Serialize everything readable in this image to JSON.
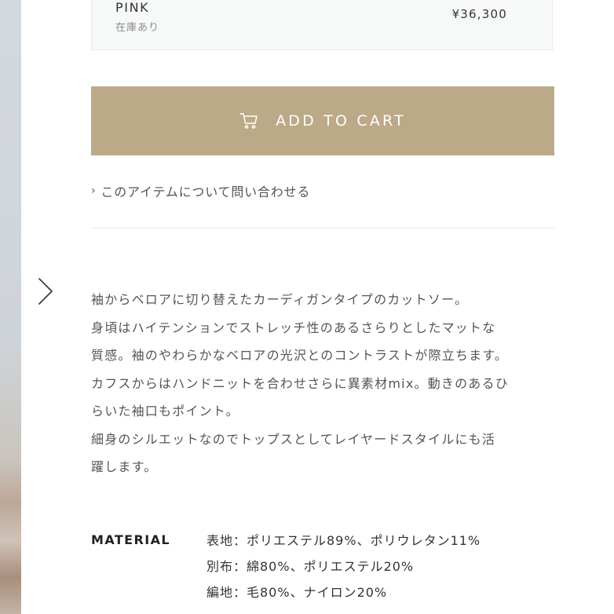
{
  "variant": {
    "color_name": "PINK",
    "stock_status": "在庫あり",
    "price": "¥36,300"
  },
  "cart_button": {
    "label": "ADD TO CART",
    "icon": "cart-icon",
    "background_color": "#bca987"
  },
  "inquiry": {
    "label": "このアイテムについて問い合わせる",
    "icon": "chevron-right-icon"
  },
  "carousel": {
    "next_icon": "chevron-right-icon"
  },
  "description": {
    "lines": [
      "袖からベロアに切り替えたカーディガンタイプのカットソー。",
      "身頃はハイテンションでストレッチ性のあるさらりとしたマットな",
      "質感。袖のやわらかなベロアの光沢とのコントラストが際立ちます。",
      "カフスからはハンドニットを合わせさらに異素材mix。動きのあるひ",
      "らいた袖口もポイント。",
      "細身のシルエットなのでトップスとしてレイヤードスタイルにも活",
      "躍します。"
    ]
  },
  "material": {
    "label": "MATERIAL",
    "lines": [
      "表地：ポリエステル89%、ポリウレタン11%",
      "別布：綿80%、ポリエステル20%",
      "編地：毛80%、ナイロン20%"
    ]
  }
}
